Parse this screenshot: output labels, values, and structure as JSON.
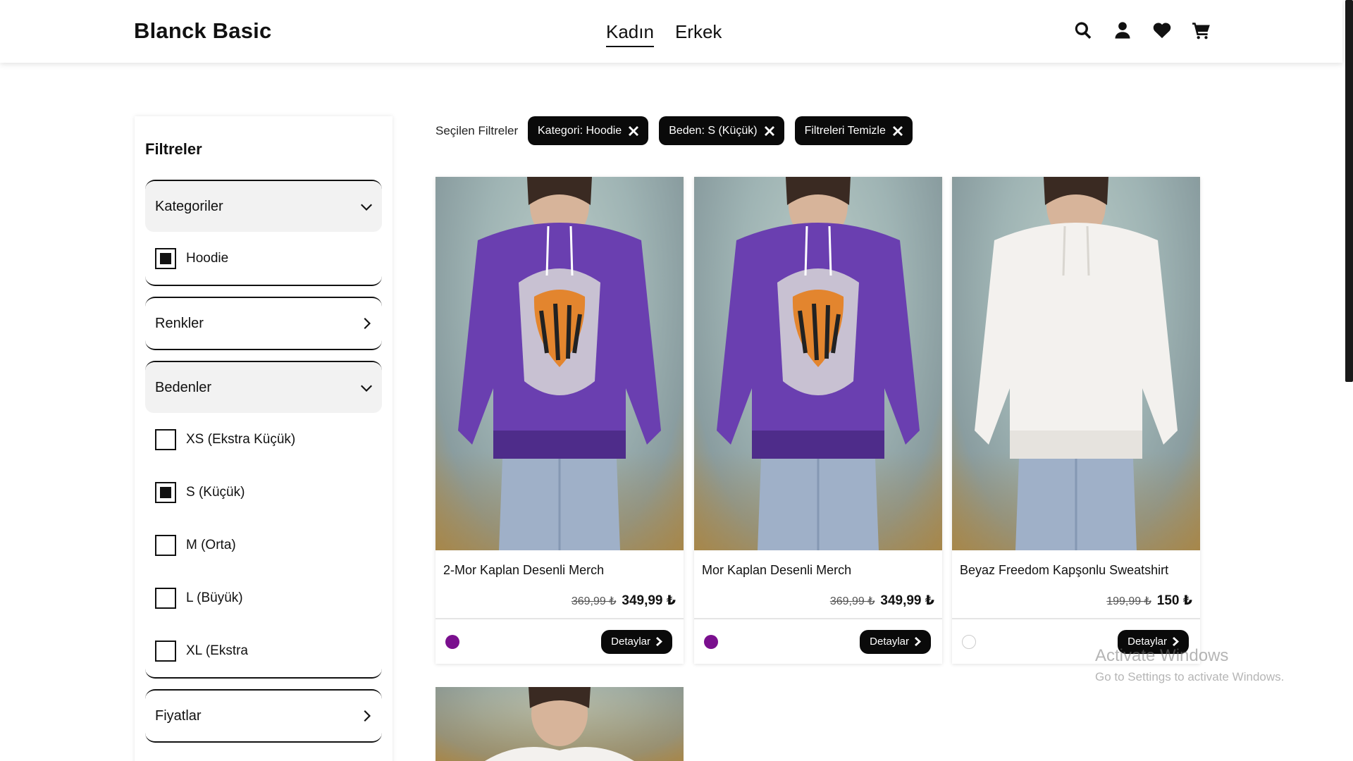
{
  "header": {
    "logo": "Blanck Basic",
    "nav": [
      {
        "label": "Kadın",
        "active": true
      },
      {
        "label": "Erkek",
        "active": false
      }
    ],
    "icons": [
      "search-icon",
      "user-icon",
      "heart-icon",
      "cart-icon"
    ]
  },
  "sidebar": {
    "title": "Filtreler",
    "groups": {
      "categories": {
        "label": "Kategoriler",
        "expanded": true,
        "options": [
          {
            "label": "Hoodie",
            "checked": true
          }
        ]
      },
      "colors": {
        "label": "Renkler",
        "expanded": false
      },
      "sizes": {
        "label": "Bedenler",
        "expanded": true,
        "options": [
          {
            "label": "XS (Ekstra Küçük)",
            "checked": false
          },
          {
            "label": "S (Küçük)",
            "checked": true
          },
          {
            "label": "M (Orta)",
            "checked": false
          },
          {
            "label": "L (Büyük)",
            "checked": false
          },
          {
            "label": "XL (Ekstra",
            "checked": false
          }
        ]
      },
      "prices": {
        "label": "Fiyatlar",
        "expanded": false
      }
    }
  },
  "selected_filters": {
    "label": "Seçilen Filtreler",
    "chips": [
      "Kategori: Hoodie",
      "Beden: S (Küçük)",
      "Filtreleri Temizle"
    ]
  },
  "products": [
    {
      "name": "2-Mor Kaplan Desenli Merch",
      "old_price": "369,99 ₺",
      "price": "349,99 ₺",
      "color": "#7a0f8e",
      "button": "Detaylar",
      "garment_color": "#6a3fb0"
    },
    {
      "name": "Mor Kaplan Desenli Merch",
      "old_price": "369,99 ₺",
      "price": "349,99 ₺",
      "color": "#7a0f8e",
      "button": "Detaylar",
      "garment_color": "#6a3fb0"
    },
    {
      "name": "Beyaz Freedom Kapşonlu Sweatshirt",
      "old_price": "199,99 ₺",
      "price": "150 ₺",
      "color": "#ffffff",
      "button": "Detaylar",
      "garment_color": "#f3f1ee"
    }
  ],
  "watermark": {
    "line1": "Activate Windows",
    "line2": "Go to Settings to activate Windows."
  }
}
